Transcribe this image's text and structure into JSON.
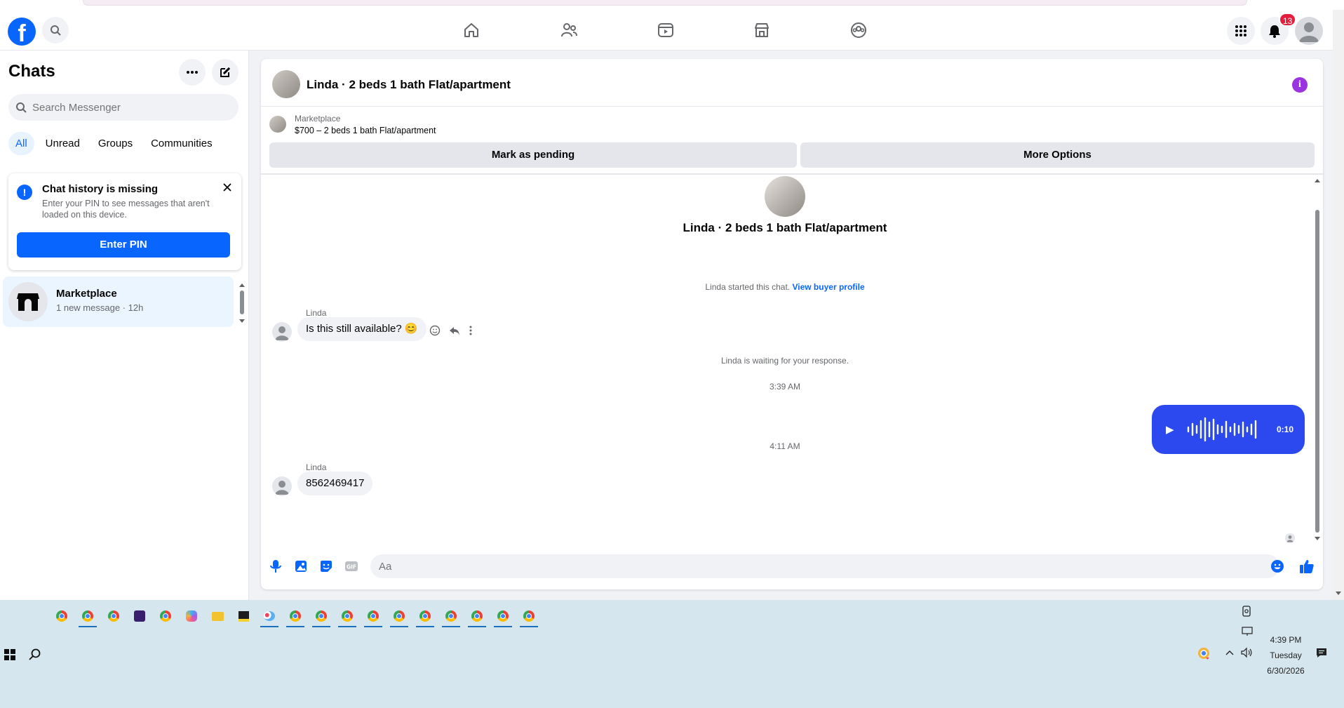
{
  "topbar": {
    "logo_letter": "f",
    "notification_count": "13"
  },
  "left_panel": {
    "title": "Chats",
    "search_placeholder": "Search Messenger",
    "tabs": [
      "All",
      "Unread",
      "Groups",
      "Communities"
    ],
    "notice": {
      "title": "Chat history is missing",
      "body": "Enter your PIN to see messages that aren't loaded on this device.",
      "button": "Enter PIN"
    },
    "conversation": {
      "name": "Marketplace",
      "subtitle": "1 new message · 12h"
    }
  },
  "chat": {
    "header_title": "Linda · 2 beds 1 bath Flat/apartment",
    "listing": {
      "source": "Marketplace",
      "price_title": "$700 – 2 beds 1 bath Flat/apartment",
      "mark_pending": "Mark as pending",
      "more_options": "More Options"
    },
    "center_title": "Linda · 2 beds 1 bath Flat/apartment",
    "started_text": "Linda started this chat.",
    "view_profile": "View buyer profile",
    "messages": [
      {
        "sender": "Linda",
        "text": "Is this still available? 😊"
      },
      {
        "sender": "Linda",
        "text": "8562469417"
      }
    ],
    "waiting_text": "Linda is waiting for your response.",
    "time1": "3:39 AM",
    "time2": "4:11 AM",
    "voice_duration": "0:10",
    "composer_placeholder": "Aa"
  },
  "taskbar": {
    "time": "4:39 PM",
    "day": "Tuesday",
    "date": "6/30/2026"
  }
}
